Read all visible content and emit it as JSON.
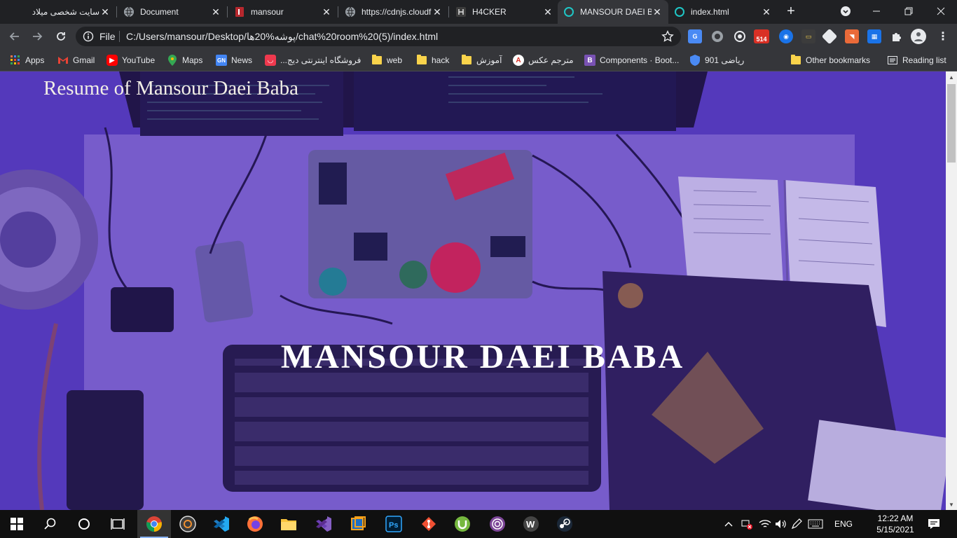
{
  "tabs": [
    {
      "label": "سایت شخصی میلاد",
      "favicon": "blank-icon"
    },
    {
      "label": "Document",
      "favicon": "globe-icon"
    },
    {
      "label": "mansour",
      "favicon": "red-doc-icon"
    },
    {
      "label": "https://cdnjs.cloudflare.com",
      "favicon": "globe-icon"
    },
    {
      "label": "H4CKER",
      "favicon": "hacker-icon"
    },
    {
      "label": "MANSOUR DAEI BABA",
      "favicon": "teal-ring-icon",
      "active": true
    },
    {
      "label": "index.html",
      "favicon": "teal-ring-icon"
    }
  ],
  "omnibox": {
    "scheme_label": "File",
    "url": "C:/Users/mansour/Desktop/پوشه%20ها/chat%20room%20(5)/index.html"
  },
  "extensions": {
    "gmail_badge": "514"
  },
  "bookmarks": [
    {
      "label": "Apps",
      "icon": "apps-grid-icon"
    },
    {
      "label": "Gmail",
      "icon": "gmail-icon"
    },
    {
      "label": "YouTube",
      "icon": "youtube-icon"
    },
    {
      "label": "Maps",
      "icon": "maps-icon"
    },
    {
      "label": "News",
      "icon": "news-icon"
    },
    {
      "label": "فروشگاه اینترنتی دیج...",
      "icon": "digikala-icon"
    },
    {
      "label": "web",
      "icon": "folder-icon"
    },
    {
      "label": "hack",
      "icon": "folder-icon"
    },
    {
      "label": "آموزش",
      "icon": "folder-icon"
    },
    {
      "label": "مترجم عکس",
      "icon": "translate-icon"
    },
    {
      "label": "Components · Boot...",
      "icon": "bootstrap-icon"
    },
    {
      "label": "ریاضی 901",
      "icon": "shield-icon"
    },
    {
      "label": "Other bookmarks",
      "icon": "folder-icon"
    },
    {
      "label": "Reading list",
      "icon": "reading-list-icon"
    }
  ],
  "page": {
    "header_title": "Resume of Mansour Daei Baba",
    "hero_name": "MANSOUR DAEI BABA"
  },
  "taskbar": {
    "apps": [
      "chrome-icon",
      "media-player-icon",
      "vscode-icon",
      "firefox-icon",
      "file-explorer-icon",
      "visual-studio-icon",
      "virtualbox-icon",
      "photoshop-icon",
      "git-icon",
      "utorrent-icon",
      "tor-icon",
      "wamp-icon",
      "steam-icon"
    ],
    "language": "ENG",
    "time": "12:22 AM",
    "date": "5/15/2021"
  },
  "colors": {
    "chrome_dark": "#202124",
    "chrome_toolbar": "#35363a",
    "hero_overlay": "#4b2fa8",
    "accent": "#8ab4f8"
  }
}
